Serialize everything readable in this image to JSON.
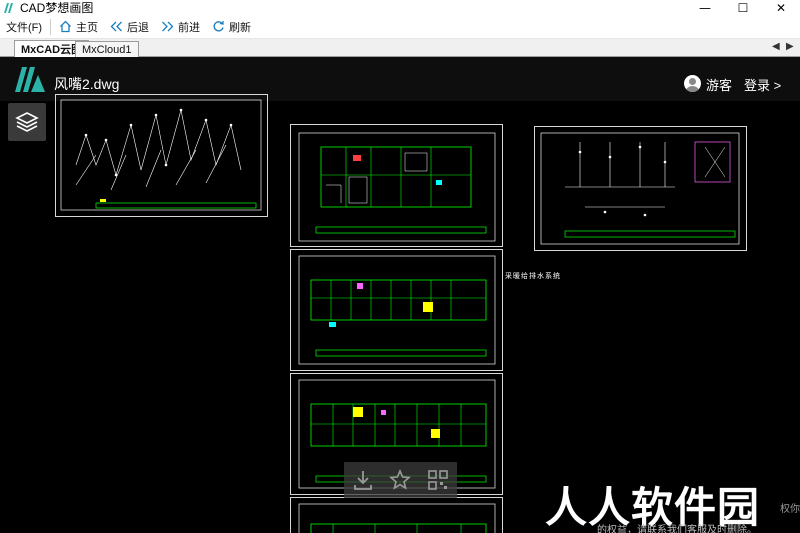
{
  "window": {
    "title": "CAD梦想画图",
    "minimize": "—",
    "maximize": "☐",
    "close": "✕"
  },
  "toolbar": {
    "file_menu": "文件(F)",
    "home": "主页",
    "back": "后退",
    "forward": "前进",
    "refresh": "刷新"
  },
  "tabs": [
    {
      "label": "MxCAD云图",
      "active": true
    },
    {
      "label": "MxCloud1",
      "active": false
    }
  ],
  "tab_nav": {
    "prev": "◀",
    "next": "▶"
  },
  "viewer": {
    "file_name": "风嘴2.dwg",
    "guest": "游客",
    "login": "登录 >",
    "drawing_note": "采暖给排水系统"
  },
  "watermark": {
    "big": "人人软件园",
    "small": "的权益，请联系我们客服及时删除。",
    "right_fragment": "权你"
  },
  "colors": {
    "viewer_bg": "#000000",
    "cad_line": "#00ff00",
    "cad_accent": "#ffff00",
    "cad_red": "#ff4040",
    "cad_cyan": "#00ffff",
    "brand": "#2bb3a8"
  }
}
